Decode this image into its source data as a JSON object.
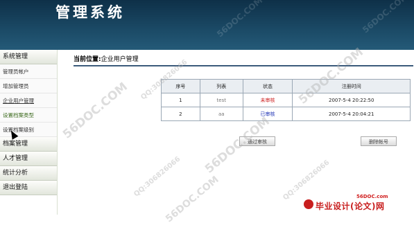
{
  "header": {
    "title": "管理系统",
    "watermark": "56DOC.COM"
  },
  "sidebar": {
    "sections": [
      {
        "label": "系统管理",
        "items": [
          {
            "label": "管理员帐户"
          },
          {
            "label": "增加管理员"
          },
          {
            "label": "企业用户管理"
          },
          {
            "label": "设置档案类型",
            "active": true
          },
          {
            "label": "设置档案级别"
          }
        ]
      },
      {
        "label": "档案管理"
      },
      {
        "label": "人才管理"
      },
      {
        "label": "统计分析"
      },
      {
        "label": "退出登陆"
      }
    ]
  },
  "breadcrumb": {
    "label": "当前位置:",
    "value": "企业用户管理"
  },
  "table": {
    "headers": [
      "序号",
      "列表",
      "状态",
      "注册时间"
    ],
    "rows": [
      {
        "index": "1",
        "name": "test",
        "status": "未审核",
        "status_color": "#cc1b1b",
        "time": "2007-5-4 20:22:50"
      },
      {
        "index": "2",
        "name": "aa",
        "status": "已审核",
        "status_color": "#1b2fb3",
        "time": "2007-5-4 20:04:21"
      }
    ]
  },
  "buttons": {
    "approve": "通过审核",
    "delete": "删除帐号"
  },
  "watermarks": {
    "site": "56DOC.COM",
    "qq": "QQ:306826066"
  },
  "logo": {
    "site": "56DOC.com",
    "text": "毕业设计(论文)网"
  }
}
